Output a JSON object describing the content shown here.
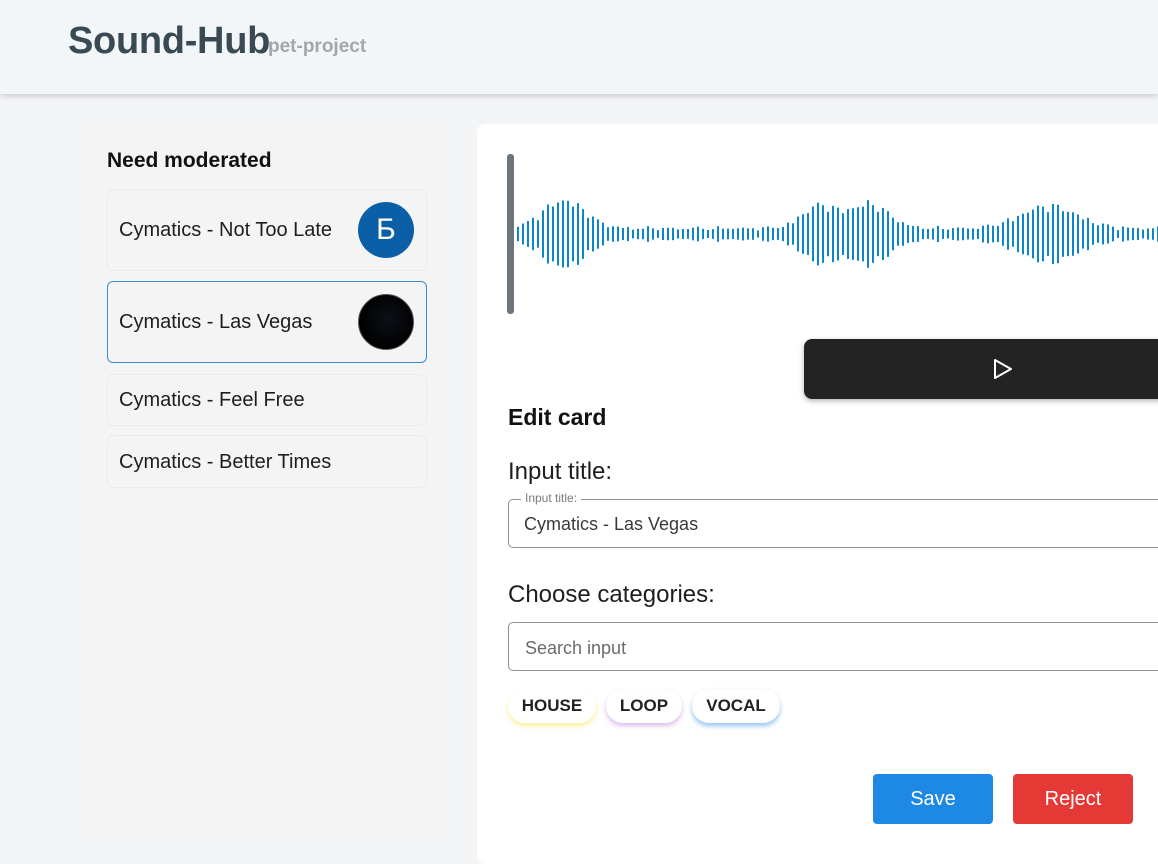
{
  "header": {
    "title": "Sound-Hub",
    "subtitle": "pet-project"
  },
  "sidebar": {
    "title": "Need moderated",
    "items": [
      {
        "label": "Cymatics - Not Too Late",
        "avatar_letter": "Б"
      },
      {
        "label": "Cymatics - Las Vegas"
      },
      {
        "label": "Cymatics - Feel Free"
      },
      {
        "label": "Cymatics - Better Times"
      }
    ]
  },
  "editor": {
    "heading": "Edit card",
    "title_section_label": "Input title:",
    "title_field": {
      "floating_label": "Input title:",
      "value": "Cymatics - Las Vegas"
    },
    "categories_section_label": "Choose categories:",
    "search_field": {
      "placeholder": "Search input"
    },
    "categories": [
      "HOUSE",
      "LOOP",
      "VOCAL"
    ],
    "save_label": "Save",
    "reject_label": "Reject"
  },
  "colors": {
    "waveform": "#0c86c8",
    "save": "#1e88e5",
    "reject": "#e53935",
    "player": "#232323"
  },
  "icons": {
    "player": "play-icon"
  }
}
